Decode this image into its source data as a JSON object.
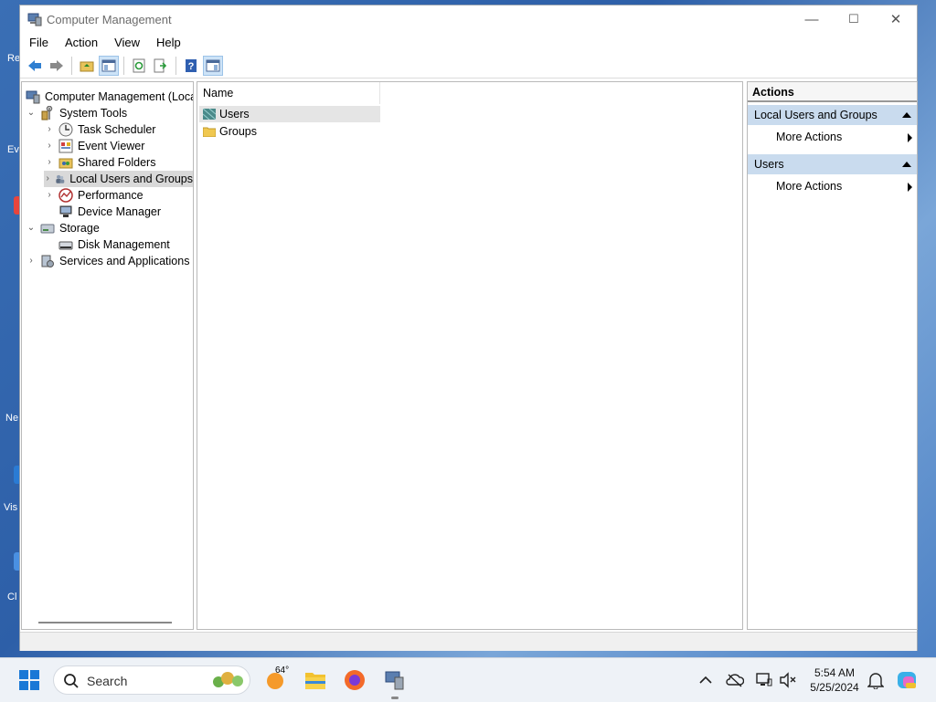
{
  "window": {
    "title": "Computer Management",
    "controls": {
      "minimize": "—",
      "maximize": "☐",
      "close": "✕"
    }
  },
  "menu": [
    "File",
    "Action",
    "View",
    "Help"
  ],
  "tree": {
    "items": [
      {
        "label": "Computer Management (Local",
        "chev": ""
      },
      {
        "label": "System Tools",
        "chev": "⌄"
      },
      {
        "label": "Task Scheduler",
        "chev": "›"
      },
      {
        "label": "Event Viewer",
        "chev": "›"
      },
      {
        "label": "Shared Folders",
        "chev": "›"
      },
      {
        "label": "Local Users and Groups",
        "chev": "›"
      },
      {
        "label": "Performance",
        "chev": "›"
      },
      {
        "label": "Device Manager",
        "chev": ""
      },
      {
        "label": "Storage",
        "chev": "⌄"
      },
      {
        "label": "Disk Management",
        "chev": ""
      },
      {
        "label": "Services and Applications",
        "chev": "›"
      }
    ]
  },
  "list": {
    "column_name": "Name",
    "rows": [
      "Users",
      "Groups"
    ]
  },
  "actions": {
    "title": "Actions",
    "sections": [
      {
        "label": "Local Users and Groups",
        "item": "More Actions"
      },
      {
        "label": "Users",
        "item": "More Actions"
      }
    ]
  },
  "taskbar": {
    "search_label": "Search",
    "weather_temp": "64°",
    "time": "5:54 AM",
    "date": "5/25/2024"
  },
  "desktop_fragments": [
    "Re",
    "Ev",
    "Ne",
    "Vis",
    "Cl"
  ]
}
